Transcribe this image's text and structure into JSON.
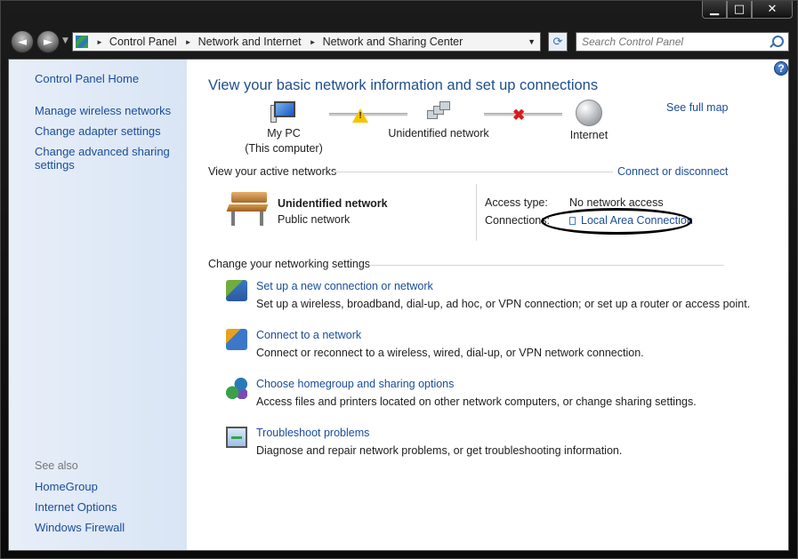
{
  "window": {
    "caption": {
      "minimize": "▁",
      "maximize": "□",
      "close": "✕"
    },
    "nav": {
      "back_glyph": "◄",
      "forward_glyph": "►",
      "breadcrumb": [
        "Control Panel",
        "Network and Internet",
        "Network and Sharing Center"
      ],
      "search_placeholder": "Search Control Panel"
    }
  },
  "sidebar": {
    "home": "Control Panel Home",
    "links": [
      "Manage wireless networks",
      "Change adapter settings",
      "Change advanced sharing settings"
    ],
    "see_also_title": "See also",
    "see_also": [
      "HomeGroup",
      "Internet Options",
      "Windows Firewall"
    ]
  },
  "main": {
    "title": "View your basic network information and set up connections",
    "see_full_map": "See full map",
    "map": {
      "pc_line1": "My PC",
      "pc_line2": "(This computer)",
      "network": "Unidentified network",
      "internet": "Internet"
    },
    "active": {
      "heading": "View your active networks",
      "connect_link": "Connect or disconnect",
      "network_name": "Unidentified network",
      "network_type": "Public network",
      "access_type_label": "Access type:",
      "access_type_value": "No network access",
      "connections_label": "Connections:",
      "connections_value": "Local Area Connection"
    },
    "settings": {
      "heading": "Change your networking settings",
      "tasks": [
        {
          "title": "Set up a new connection or network",
          "desc": "Set up a wireless, broadband, dial-up, ad hoc, or VPN connection; or set up a router or access point."
        },
        {
          "title": "Connect to a network",
          "desc": "Connect or reconnect to a wireless, wired, dial-up, or VPN network connection."
        },
        {
          "title": "Choose homegroup and sharing options",
          "desc": "Access files and printers located on other network computers, or change sharing settings."
        },
        {
          "title": "Troubleshoot problems",
          "desc": "Diagnose and repair network problems, or get troubleshooting information."
        }
      ]
    }
  },
  "colors": {
    "link": "#1a4d99",
    "title": "#1f4e8c",
    "sidebar": "#e4ecf7",
    "warning": "#f5c400",
    "error_x": "#d91a1a"
  }
}
